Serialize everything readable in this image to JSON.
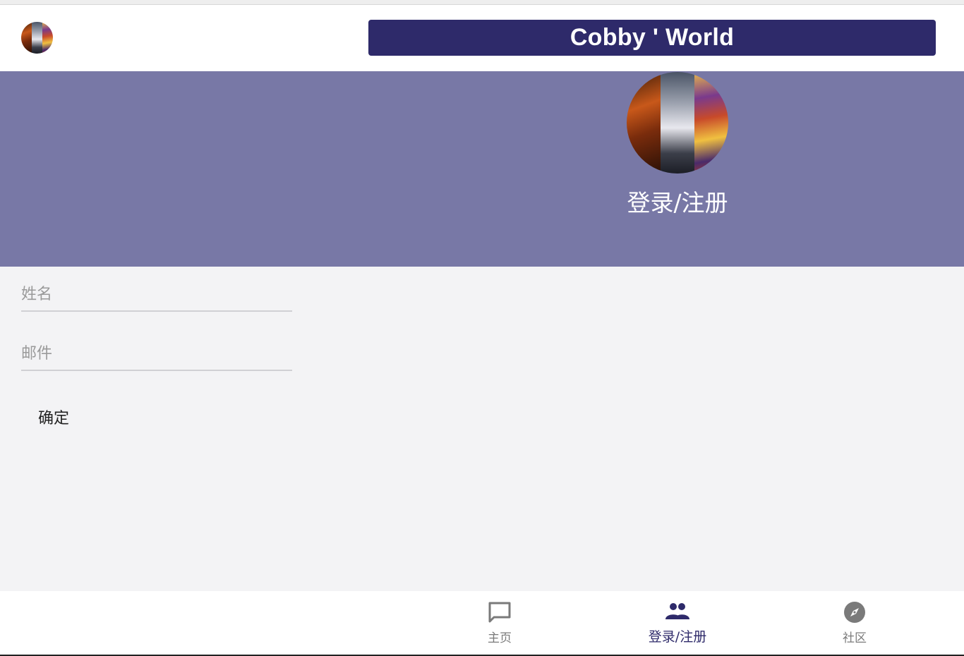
{
  "app": {
    "title": "Cobby ' World"
  },
  "header": {
    "avatar_alt": "user-avatar"
  },
  "banner": {
    "label": "登录/注册"
  },
  "form": {
    "name": {
      "placeholder": "姓名",
      "value": ""
    },
    "email": {
      "placeholder": "邮件",
      "value": ""
    },
    "confirm_label": "确定"
  },
  "bottom_nav": {
    "items": [
      {
        "label": "主页",
        "icon": "chat-bubble-icon",
        "active": false
      },
      {
        "label": "登录/注册",
        "icon": "people-icon",
        "active": true
      },
      {
        "label": "社区",
        "icon": "compass-icon",
        "active": false
      }
    ]
  },
  "colors": {
    "primary": "#2e2a6a",
    "banner": "#7878a6",
    "background": "#f3f3f5",
    "inactive": "#7a7a7a"
  }
}
